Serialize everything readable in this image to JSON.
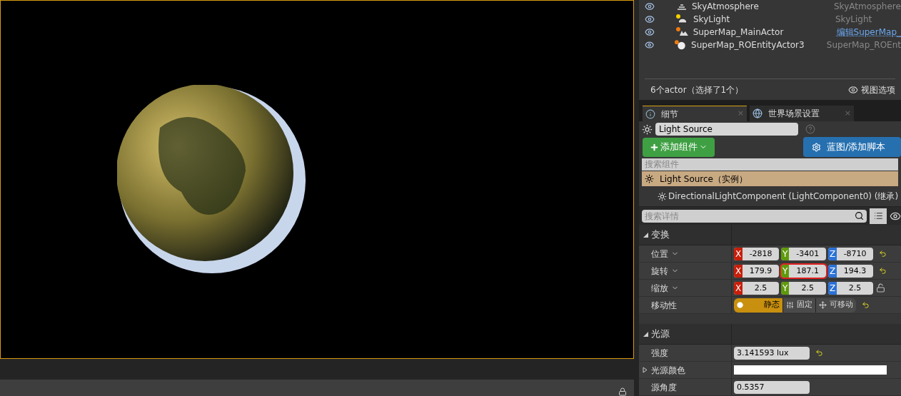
{
  "outliner": {
    "rows": [
      {
        "kind": "atmosphere",
        "name": "SkyAtmosphere",
        "type": "SkyAtmosphere",
        "type_is_link": false
      },
      {
        "kind": "skylight",
        "name": "SkyLight",
        "type": "SkyLight",
        "type_is_link": false
      },
      {
        "kind": "actor",
        "name": "SuperMap_MainActor",
        "type": "编辑SuperMap_",
        "type_is_link": true
      },
      {
        "kind": "sphere",
        "name": "SuperMap_ROEntityActor3",
        "type": "SuperMap_ROEnt",
        "type_is_link": false
      }
    ],
    "status": "6个actor（选择了1个）",
    "view_options": "视图选项"
  },
  "details": {
    "tabs": [
      {
        "label": "细节",
        "selected": true,
        "close": "×"
      },
      {
        "label": "世界场景设置",
        "selected": false,
        "close": "×"
      }
    ],
    "actor_name": "Light Source",
    "add_component": "添加组件",
    "blueprint": "蓝图/添加脚本",
    "component_search_placeholder": "搜索组件",
    "components": [
      {
        "label": "Light Source（实例）",
        "selected": true,
        "children": [
          {
            "label": "DirectionalLightComponent (LightComponent0) (继承)",
            "selected": false
          }
        ]
      }
    ],
    "details_search_placeholder": "搜索详情",
    "categories": [
      {
        "title": "变换",
        "expanded": true,
        "rows": [
          {
            "kind": "vector",
            "label": "位置",
            "reset": true,
            "fields": [
              {
                "axis": "X",
                "color": "#c81e0a",
                "value": "-2818",
                "highlighted": false
              },
              {
                "axis": "Y",
                "color": "#5f9a0c",
                "value": "-3401",
                "highlighted": false
              },
              {
                "axis": "Z",
                "color": "#2c72d6",
                "value": "-8710",
                "highlighted": false
              }
            ]
          },
          {
            "kind": "vector",
            "label": "旋转",
            "reset": true,
            "fields": [
              {
                "axis": "X",
                "color": "#c81e0a",
                "value": "179.9",
                "highlighted": false
              },
              {
                "axis": "Y",
                "color": "#5f9a0c",
                "value": "187.1",
                "highlighted": true
              },
              {
                "axis": "Z",
                "color": "#2c72d6",
                "value": "194.3",
                "highlighted": false
              }
            ]
          },
          {
            "kind": "vector",
            "label": "缩放",
            "reset": false,
            "lock_open": true,
            "fields": [
              {
                "axis": "X",
                "color": "#c81e0a",
                "value": "2.5",
                "highlighted": false
              },
              {
                "axis": "Y",
                "color": "#5f9a0c",
                "value": "2.5",
                "highlighted": false
              },
              {
                "axis": "Z",
                "color": "#2c72d6",
                "value": "2.5",
                "highlighted": false
              }
            ]
          },
          {
            "kind": "mobility",
            "label": "移动性",
            "reset": true,
            "options": [
              {
                "label": "静态",
                "selected": true
              },
              {
                "label": "固定",
                "selected": false
              },
              {
                "label": "可移动",
                "selected": false
              }
            ]
          }
        ]
      },
      {
        "title": "光源",
        "expanded": true,
        "rows": [
          {
            "kind": "scalar",
            "label": "强度",
            "reset": true,
            "value": "3.141593 lux"
          },
          {
            "kind": "color",
            "label": "光源颜色",
            "reset": false,
            "color": "#ffffff",
            "expanded": false
          },
          {
            "kind": "scalar",
            "label": "源角度",
            "reset": false,
            "value": "0.5357"
          }
        ]
      }
    ]
  }
}
